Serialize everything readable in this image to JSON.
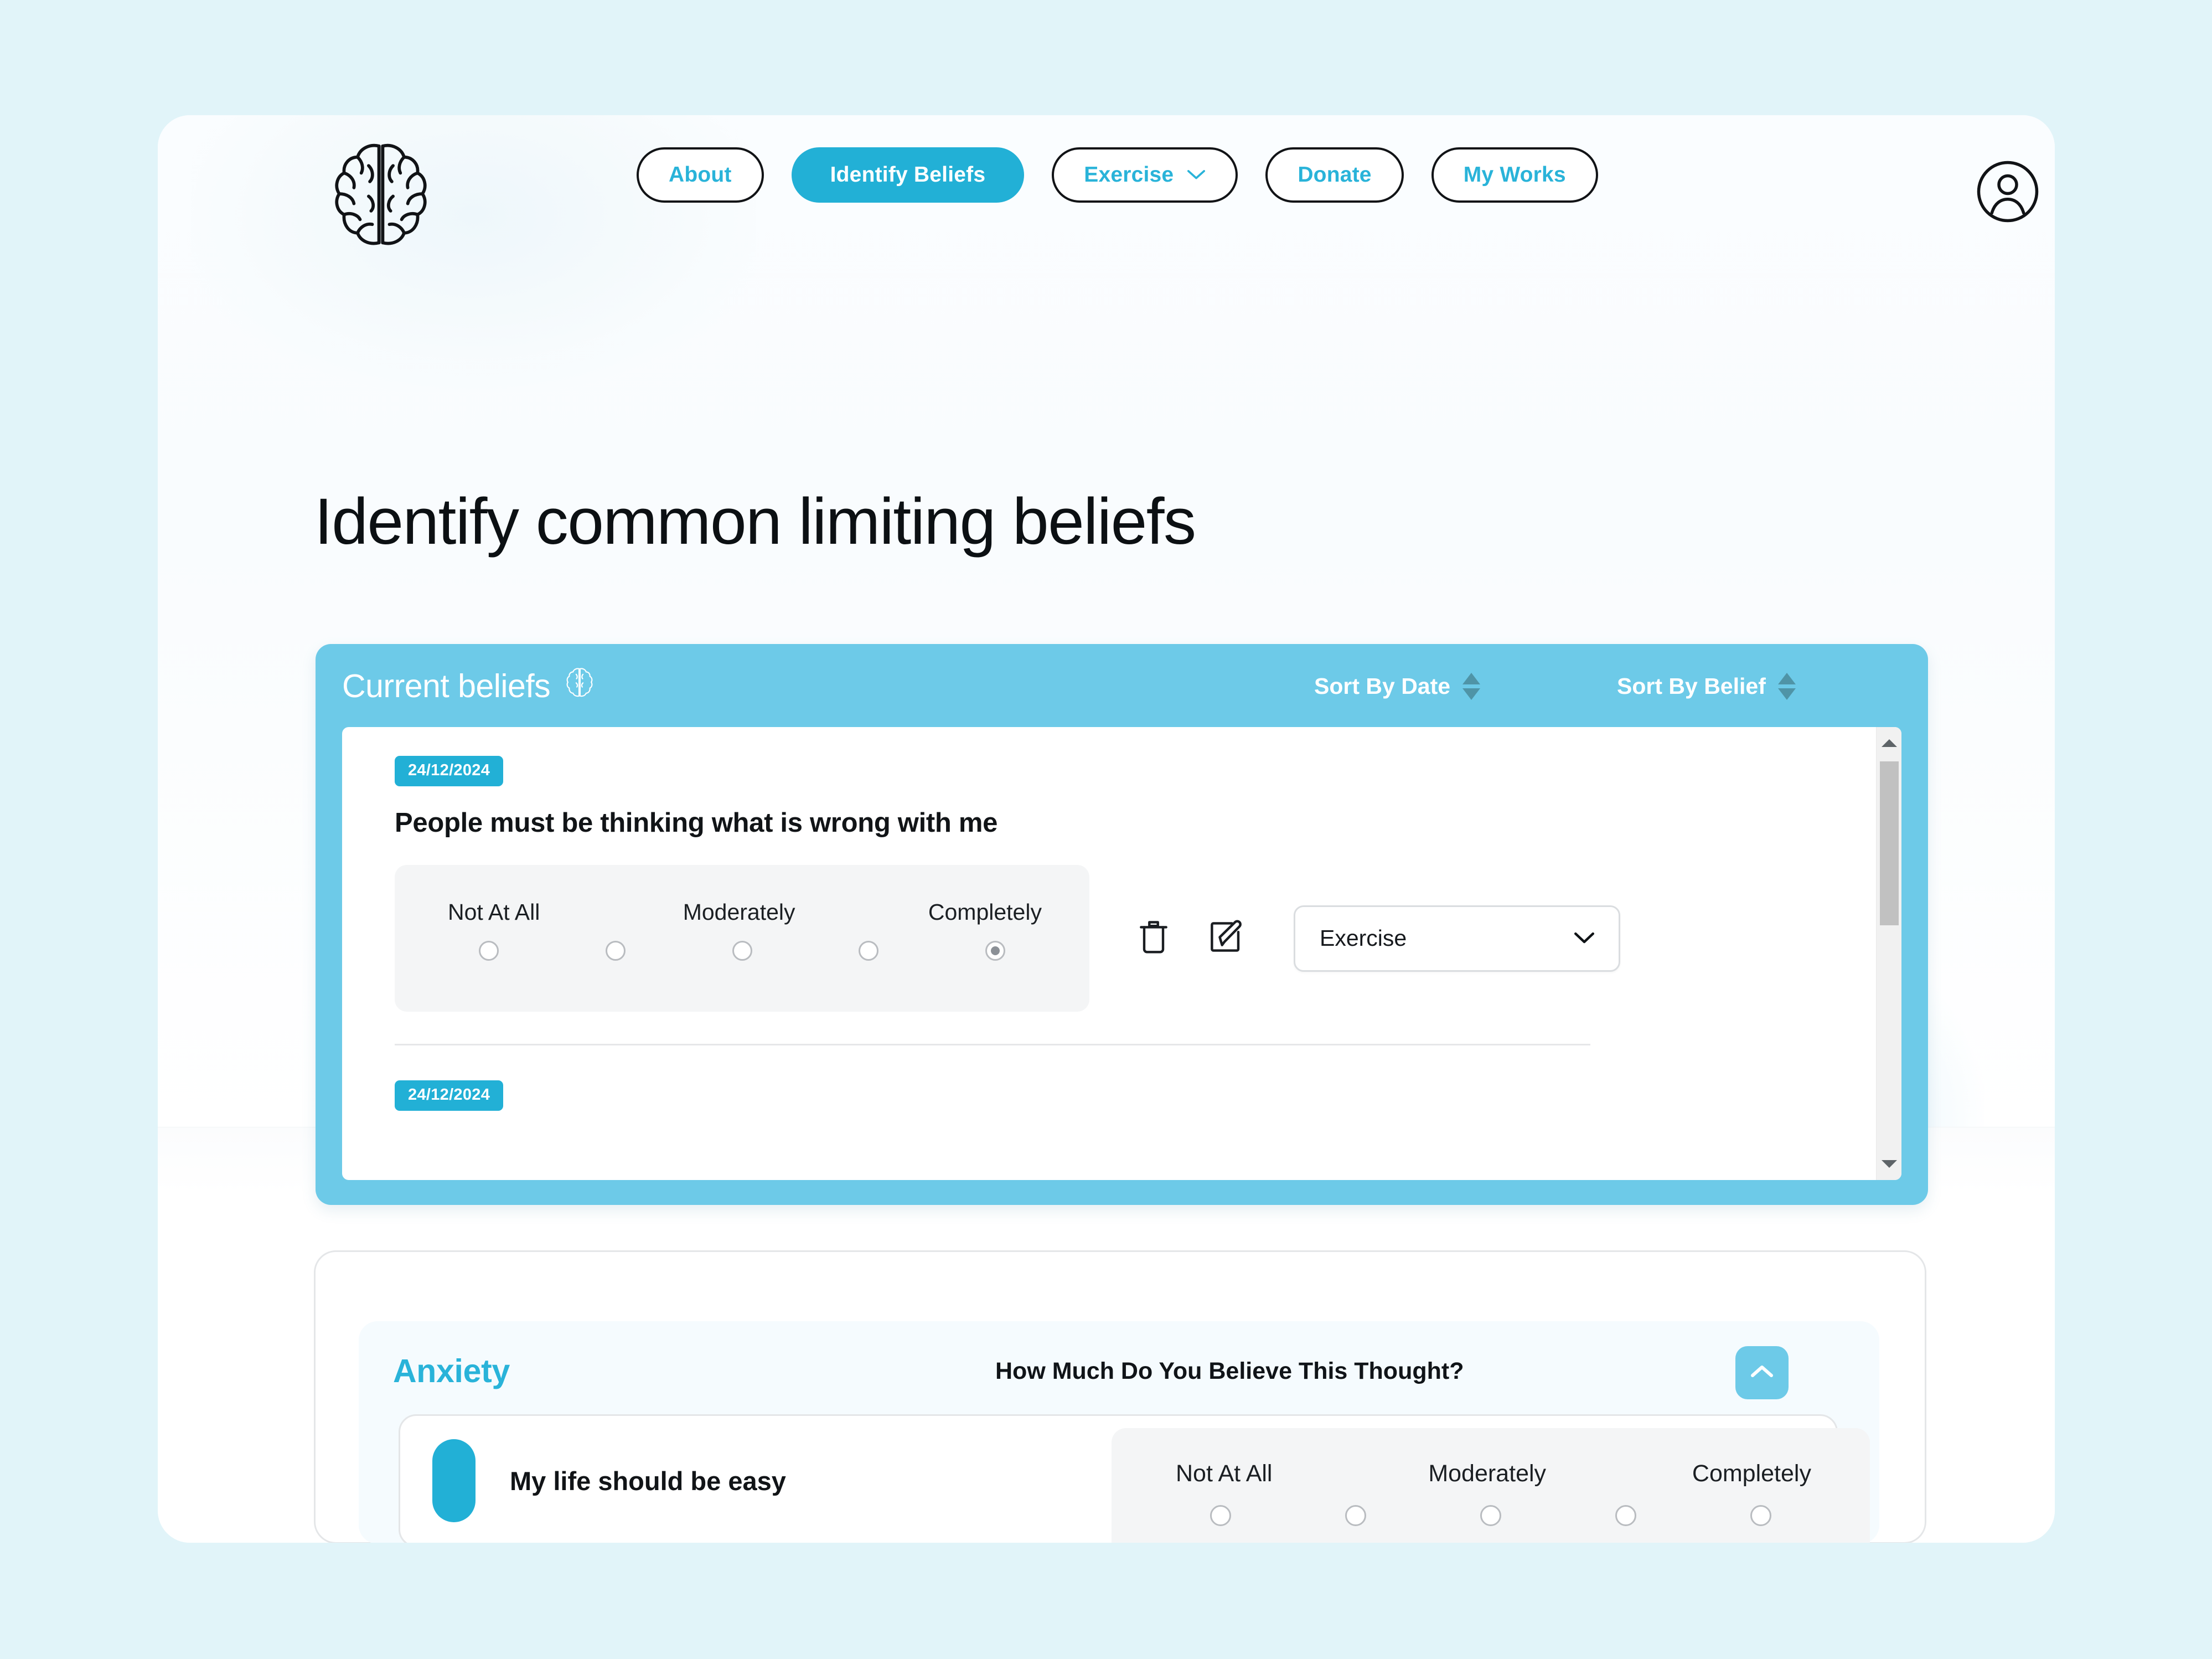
{
  "nav": {
    "logo_icon": "brain-icon",
    "items": [
      {
        "label": "About",
        "active": false,
        "has_caret": false
      },
      {
        "label": "Identify Beliefs",
        "active": true,
        "has_caret": false
      },
      {
        "label": "Exercise",
        "active": false,
        "has_caret": true
      },
      {
        "label": "Donate",
        "active": false,
        "has_caret": false
      },
      {
        "label": "My Works",
        "active": false,
        "has_caret": false
      }
    ],
    "account_icon": "user-circle-icon"
  },
  "page": {
    "title": "Identify common limiting beliefs"
  },
  "beliefs_panel": {
    "title": "Current beliefs",
    "title_icon": "brain-icon",
    "sort_date_label": "Sort By Date",
    "sort_belief_label": "Sort By Belief",
    "sort_icon": "sort-updown-icon",
    "scroll_up_icon": "chevron-up-icon",
    "scroll_down_icon": "chevron-down-icon",
    "entries": [
      {
        "date": "24/12/2024",
        "belief": "People must be thinking what is wrong with me",
        "scale": {
          "labels": [
            "Not At All",
            "Moderately",
            "Completely"
          ],
          "options": 5,
          "selected_index": 4
        },
        "delete_icon": "trash-icon",
        "edit_icon": "edit-square-icon",
        "exercise_select": {
          "value": "Exercise",
          "caret_icon": "chevron-down-icon"
        }
      },
      {
        "date": "24/12/2024"
      }
    ]
  },
  "exercise_section": {
    "category": "Anxiety",
    "question": "How Much Do You Believe This Thought?",
    "collapse_icon": "chevron-up-icon",
    "rows": [
      {
        "thought": "My life should be easy",
        "scale": {
          "labels": [
            "Not At All",
            "Moderately",
            "Completely"
          ],
          "options": 5,
          "selected_index": -1
        }
      }
    ]
  },
  "colors": {
    "page_background": "#e1f4f9",
    "accent": "#22b0d6",
    "accent_light": "#6dcae8",
    "link": "#29b3d9",
    "text": "#111417"
  }
}
